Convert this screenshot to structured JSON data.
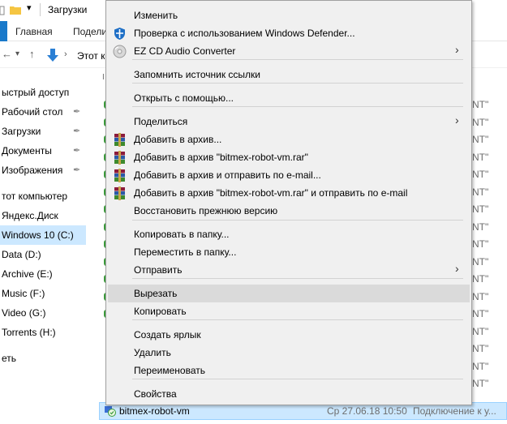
{
  "titlebar": {
    "title": "Загрузки"
  },
  "ribbon": {
    "tabs": [
      "Главная",
      "Поделиться"
    ]
  },
  "address": {
    "path": "Этот компьютер"
  },
  "sidebar": {
    "items": [
      {
        "label": "ыстрый доступ",
        "pinned": false,
        "selected": false
      },
      {
        "label": "Рабочий стол",
        "pinned": true,
        "selected": false
      },
      {
        "label": "Загрузки",
        "pinned": true,
        "selected": false
      },
      {
        "label": "Документы",
        "pinned": true,
        "selected": false
      },
      {
        "label": "Изображения",
        "pinned": true,
        "selected": false
      },
      {
        "label": "тот компьютер",
        "pinned": false,
        "selected": false
      },
      {
        "label": "Яндекс.Диск",
        "pinned": false,
        "selected": false
      },
      {
        "label": "Windows 10 (C:)",
        "pinned": false,
        "selected": true
      },
      {
        "label": "Data (D:)",
        "pinned": false,
        "selected": false
      },
      {
        "label": "Archive (E:)",
        "pinned": false,
        "selected": false
      },
      {
        "label": "Music (F:)",
        "pinned": false,
        "selected": false
      },
      {
        "label": "Video (G:)",
        "pinned": false,
        "selected": false
      },
      {
        "label": "Torrents (H:)",
        "pinned": false,
        "selected": false
      },
      {
        "label": "еть",
        "pinned": false,
        "selected": false
      }
    ]
  },
  "filelist": {
    "column_fragment": "NT\"",
    "selected_file": {
      "name": "bitmex-robot-vm",
      "date": "Ср 27.06.18 10:50",
      "type": "Подключение к у..."
    }
  },
  "context_menu": {
    "items": [
      {
        "label": "Изменить",
        "icon": "none",
        "submenu": false,
        "highlighted": false
      },
      {
        "label": "Проверка с использованием Windows Defender...",
        "icon": "windows-defender-icon",
        "submenu": false,
        "highlighted": false
      },
      {
        "label": "EZ CD Audio Converter",
        "icon": "ez-cd-icon",
        "submenu": true,
        "highlighted": false
      },
      {
        "label": "Запомнить источник ссылки",
        "icon": "none",
        "submenu": false,
        "highlighted": false
      },
      {
        "label": "Открыть с помощью...",
        "icon": "none",
        "submenu": false,
        "highlighted": false
      },
      {
        "label": "Поделиться",
        "icon": "none",
        "submenu": true,
        "highlighted": false
      },
      {
        "label": "Добавить в архив...",
        "icon": "winrar-icon",
        "submenu": false,
        "highlighted": false
      },
      {
        "label": "Добавить в архив \"bitmex-robot-vm.rar\"",
        "icon": "winrar-icon",
        "submenu": false,
        "highlighted": false
      },
      {
        "label": "Добавить в архив и отправить по e-mail...",
        "icon": "winrar-icon",
        "submenu": false,
        "highlighted": false
      },
      {
        "label": "Добавить в архив \"bitmex-robot-vm.rar\" и отправить по e-mail",
        "icon": "winrar-icon",
        "submenu": false,
        "highlighted": false
      },
      {
        "label": "Восстановить прежнюю версию",
        "icon": "none",
        "submenu": false,
        "highlighted": false
      },
      {
        "label": "Копировать в папку...",
        "icon": "none",
        "submenu": false,
        "highlighted": false
      },
      {
        "label": "Переместить в папку...",
        "icon": "none",
        "submenu": false,
        "highlighted": false
      },
      {
        "label": "Отправить",
        "icon": "none",
        "submenu": true,
        "highlighted": false
      },
      {
        "label": "Вырезать",
        "icon": "none",
        "submenu": false,
        "highlighted": true
      },
      {
        "label": "Копировать",
        "icon": "none",
        "submenu": false,
        "highlighted": false
      },
      {
        "label": "Создать ярлык",
        "icon": "none",
        "submenu": false,
        "highlighted": false
      },
      {
        "label": "Удалить",
        "icon": "none",
        "submenu": false,
        "highlighted": false
      },
      {
        "label": "Переименовать",
        "icon": "none",
        "submenu": false,
        "highlighted": false
      },
      {
        "label": "Свойства",
        "icon": "none",
        "submenu": false,
        "highlighted": false
      }
    ]
  },
  "colors": {
    "menu_bg": "#f0f0f0",
    "menu_highlight": "#dadada",
    "selection": "#cce8ff",
    "accent": "#1979ca"
  }
}
